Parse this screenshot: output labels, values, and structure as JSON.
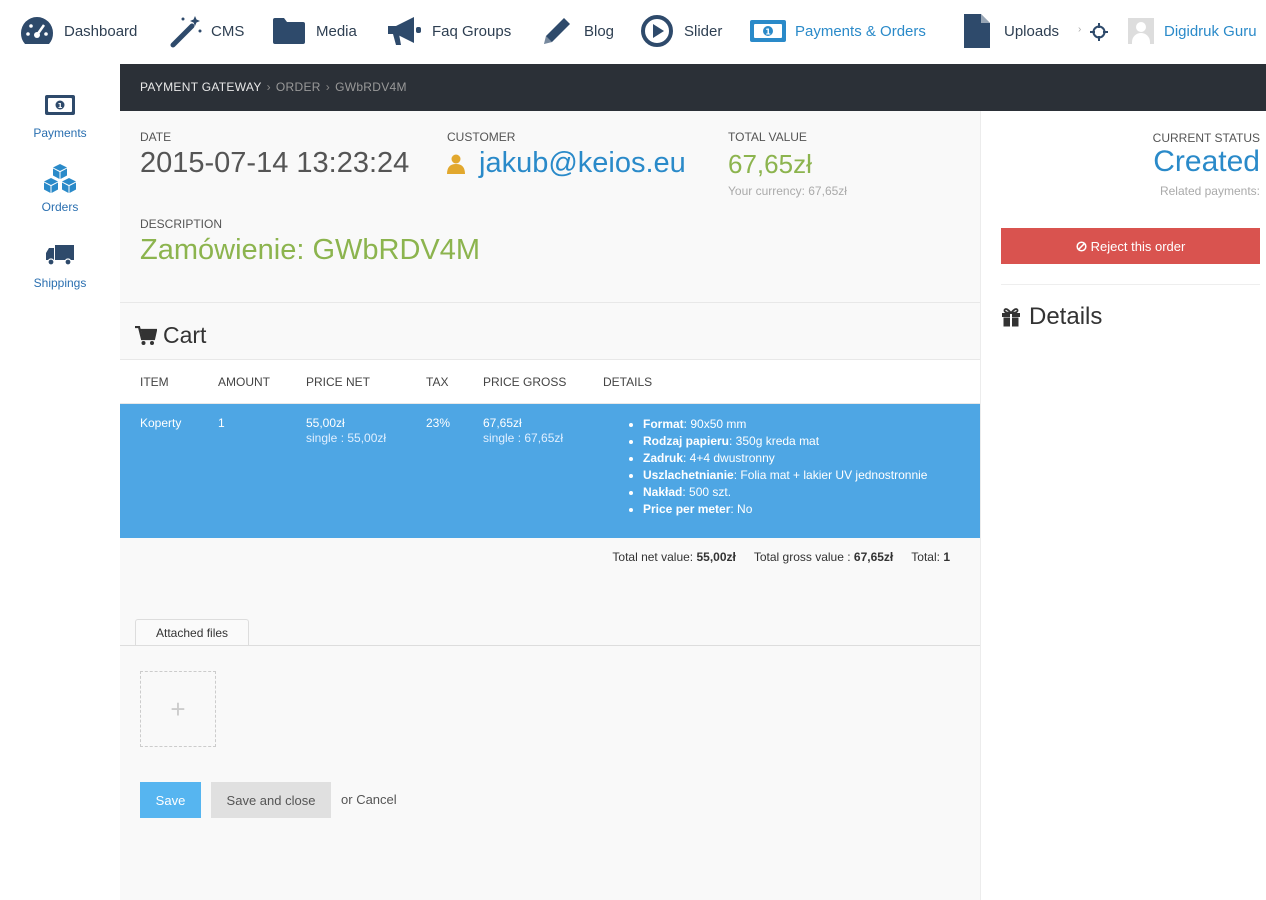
{
  "nav": {
    "items": [
      {
        "label": "Dashboard",
        "icon": "dashboard-icon"
      },
      {
        "label": "CMS",
        "icon": "magic-wand-icon"
      },
      {
        "label": "Media",
        "icon": "folder-icon"
      },
      {
        "label": "Faq Groups",
        "icon": "megaphone-icon"
      },
      {
        "label": "Blog",
        "icon": "pencil-icon"
      },
      {
        "label": "Slider",
        "icon": "play-circle-icon"
      },
      {
        "label": "Payments & Orders",
        "icon": "money-icon"
      },
      {
        "label": "Uploads",
        "icon": "file-icon"
      }
    ],
    "user": "Digidruk Guru"
  },
  "sidebar": {
    "items": [
      {
        "label": "Payments",
        "icon": "money-icon"
      },
      {
        "label": "Orders",
        "icon": "cubes-icon"
      },
      {
        "label": "Shippings",
        "icon": "truck-icon"
      }
    ]
  },
  "breadcrumb": {
    "root": "PAYMENT GATEWAY",
    "middle": "ORDER",
    "current": "GWbRDV4M"
  },
  "order": {
    "date_label": "DATE",
    "date": "2015-07-14 13:23:24",
    "customer_label": "CUSTOMER",
    "customer": "jakub@keios.eu",
    "total_label": "TOTAL VALUE",
    "total": "67,65zł",
    "currency_note": "Your currency:  67,65zł",
    "description_label": "DESCRIPTION",
    "description": "Zamówienie: GWbRDV4M"
  },
  "cart": {
    "title": "Cart",
    "headers": [
      "ITEM",
      "AMOUNT",
      "PRICE NET",
      "TAX",
      "PRICE GROSS",
      "DETAILS"
    ],
    "row": {
      "item": "Koperty",
      "amount": "1",
      "price_net": "55,00zł",
      "price_net_single": "single : 55,00zł",
      "tax": "23%",
      "price_gross": "67,65zł",
      "price_gross_single": "single : 67,65zł",
      "details": [
        {
          "key": "Format",
          "value": ": 90x50 mm"
        },
        {
          "key": "Rodzaj papieru",
          "value": ": 350g kreda mat"
        },
        {
          "key": "Zadruk",
          "value": ": 4+4 dwustronny"
        },
        {
          "key": "Uszlachetnianie",
          "value": ": Folia mat + lakier UV jednostronnie"
        },
        {
          "key": "Nakład",
          "value": ": 500 szt."
        },
        {
          "key": "Price per meter",
          "value": ": No"
        }
      ]
    },
    "totals": {
      "net_label": "Total net value:",
      "net": "55,00zł",
      "gross_label": "Total gross value :",
      "gross": "67,65zł",
      "total_label": "Total:",
      "total": "1"
    }
  },
  "files": {
    "tab": "Attached files",
    "add": "+"
  },
  "actions": {
    "save": "Save",
    "save_close": "Save and close",
    "or": "or",
    "cancel": "Cancel"
  },
  "status": {
    "label": "CURRENT STATUS",
    "value": "Created",
    "related": "Related payments:",
    "reject": "Reject this order",
    "details_title": "Details"
  },
  "colors": {
    "accent": "#2a8ac9",
    "success": "#8cb44e",
    "danger": "#d9534f",
    "row_highlight": "#4ea6e4",
    "header_dark": "#2b3037"
  }
}
